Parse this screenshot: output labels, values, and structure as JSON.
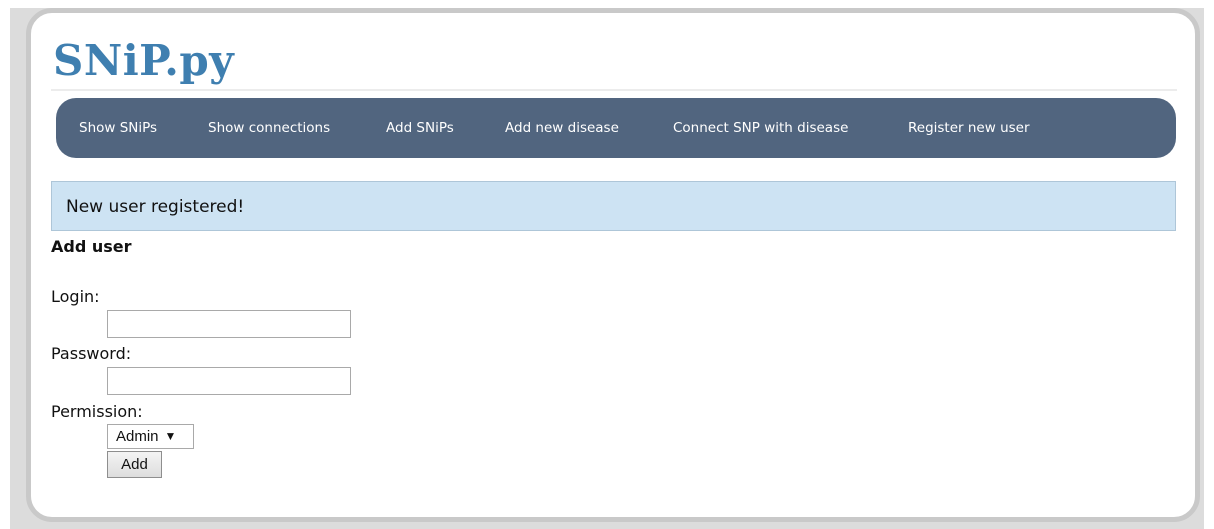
{
  "site": {
    "title": "SNiP.py"
  },
  "nav": {
    "items": [
      {
        "label": "Show SNiPs"
      },
      {
        "label": "Show connections"
      },
      {
        "label": "Add SNiPs"
      },
      {
        "label": "Add new disease"
      },
      {
        "label": "Connect SNP with disease"
      },
      {
        "label": "Register new user"
      }
    ]
  },
  "notice": {
    "message": "New user registered!"
  },
  "form": {
    "heading": "Add user",
    "login_label": "Login:",
    "login_value": "",
    "password_label": "Password:",
    "password_value": "",
    "permission_label": "Permission:",
    "permission_selected": "Admin",
    "submit_label": "Add"
  },
  "colors": {
    "title": "#3f7fb0",
    "navbar": "#51657f",
    "notice_bg": "#cde3f3"
  },
  "icons": {
    "select_arrow": "caret-down-icon"
  }
}
